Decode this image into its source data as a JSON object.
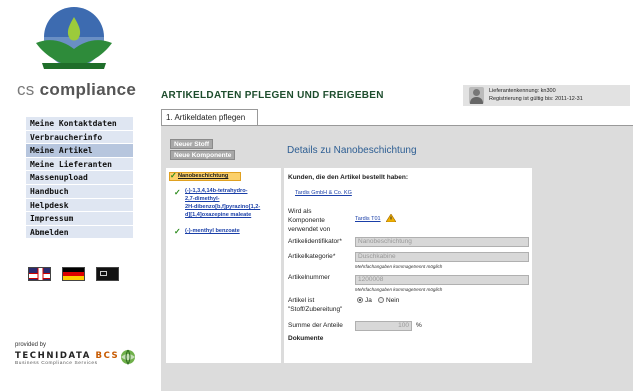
{
  "brand": {
    "name_part1": "cs ",
    "name_part2": "compliance"
  },
  "nav": {
    "items": [
      {
        "label": "Meine Kontaktdaten"
      },
      {
        "label": "Verbraucherinfo"
      },
      {
        "label": "Meine Artikel"
      },
      {
        "label": "Meine Lieferanten"
      },
      {
        "label": "Massenupload"
      },
      {
        "label": "Handbuch"
      },
      {
        "label": "Helpdesk"
      },
      {
        "label": "Impressum"
      },
      {
        "label": "Abmelden"
      }
    ],
    "active_index": 2
  },
  "flags": [
    "uk-flag",
    "german-flag",
    "other-language-flag"
  ],
  "footer": {
    "provided_by": "provided by",
    "company_a": "TECHNIDATA ",
    "company_b": "BCS",
    "company_sub": "Business Compliance Services"
  },
  "header": {
    "title": "ARTIKELDATEN PFLEGEN UND FREIGEBEN"
  },
  "user": {
    "line1": "Lieferantenkennung: kn300",
    "line2": "Registrierung ist gültig bis: 2011-12-31"
  },
  "tab": {
    "label": "1. Artikeldaten pflegen"
  },
  "toolbar": {
    "new_substance": "Neuer Stoff",
    "new_component": "Neue Komponente"
  },
  "details": {
    "heading": "Details zu Nanobeschichtung"
  },
  "tree": {
    "selected": "Nanobeschichtung",
    "item1_lines": [
      "(-)-1,3,4,14b-tetrahydro-",
      "2,7-dimethyl-",
      "2H-dibenzo[b,f]pyrazino[1,2-",
      "d][1,4]oxazepine maleate"
    ],
    "item2": "(-)-menthyl benzoate"
  },
  "form": {
    "customers_label": "Kunden, die den Artikel bestellt haben:",
    "customer_link": "Tardis GmbH & Co. KG",
    "used_as_label": "Wird als Komponente verwendet von",
    "used_as_link": "Tardis T01",
    "article_id_label": "Artikelidentifikator",
    "article_id_value": "Nanobeschichtung",
    "article_category_label": "Artikelkategorie",
    "article_category_value": "Duschkabine",
    "note": "Mehrfachangaben kommagetrennt möglich",
    "article_number_label": "Artikelnummer",
    "article_number_value": "1200008",
    "is_substance_label": "Artikel ist \"Stoff/Zubereitung\"",
    "yes": "Ja",
    "no": "Nein",
    "sum_label": "Summe der Anteile",
    "sum_value": "100",
    "sum_unit": "%",
    "documents_label": "Dokumente"
  }
}
